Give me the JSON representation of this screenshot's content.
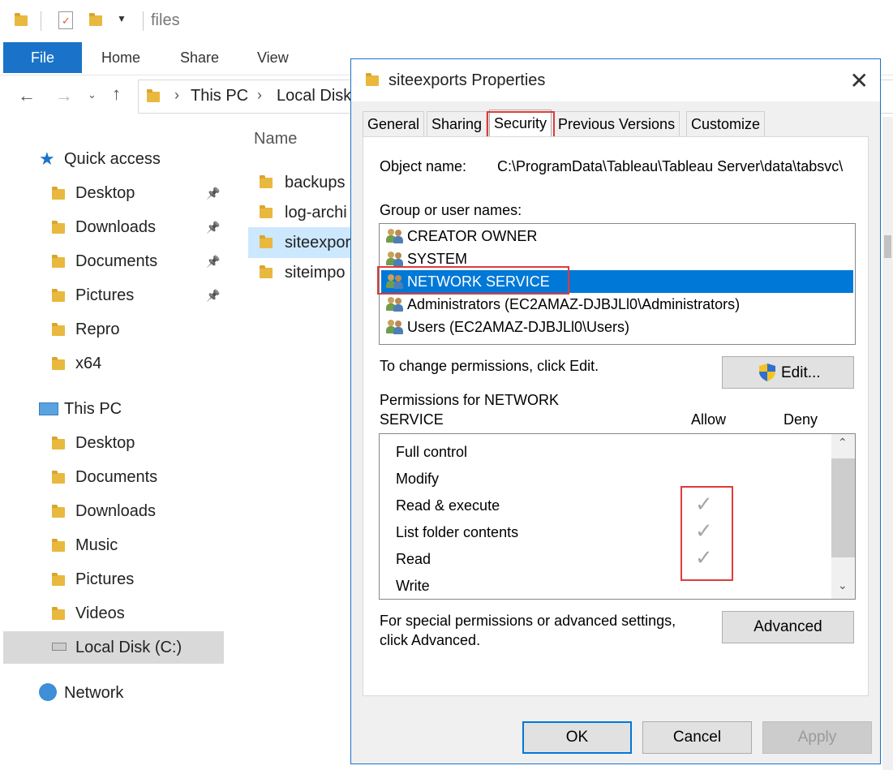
{
  "explorer": {
    "title": "files",
    "ribbon_tabs": [
      "File",
      "Home",
      "Share",
      "View"
    ],
    "address": {
      "crumbs": [
        "This PC",
        "Local Disk"
      ]
    },
    "sidebar": {
      "quick_access": "Quick access",
      "quick_items": [
        {
          "label": "Desktop",
          "pinned": true,
          "icon": "desktop-folder-icon"
        },
        {
          "label": "Downloads",
          "pinned": true,
          "icon": "downloads-folder-icon"
        },
        {
          "label": "Documents",
          "pinned": true,
          "icon": "documents-folder-icon"
        },
        {
          "label": "Pictures",
          "pinned": true,
          "icon": "pictures-folder-icon"
        },
        {
          "label": "Repro",
          "pinned": false,
          "icon": "folder-icon"
        },
        {
          "label": "x64",
          "pinned": false,
          "icon": "folder-icon"
        }
      ],
      "this_pc": "This PC",
      "pc_items": [
        {
          "label": "Desktop",
          "icon": "desktop-folder-icon"
        },
        {
          "label": "Documents",
          "icon": "documents-folder-icon"
        },
        {
          "label": "Downloads",
          "icon": "downloads-folder-icon"
        },
        {
          "label": "Music",
          "icon": "music-folder-icon"
        },
        {
          "label": "Pictures",
          "icon": "pictures-folder-icon"
        },
        {
          "label": "Videos",
          "icon": "videos-folder-icon"
        },
        {
          "label": "Local Disk (C:)",
          "icon": "drive-icon",
          "selected": true
        }
      ],
      "network": "Network"
    },
    "content": {
      "column_name": "Name",
      "files": [
        {
          "name": "backups"
        },
        {
          "name": "log-archi"
        },
        {
          "name": "siteexpor",
          "selected": true
        },
        {
          "name": "siteimpo"
        }
      ]
    }
  },
  "dialog": {
    "title": "siteexports Properties",
    "tabs": [
      "General",
      "Sharing",
      "Security",
      "Previous Versions",
      "Customize"
    ],
    "active_tab": "Security",
    "object_name_label": "Object name:",
    "object_name_value": "C:\\ProgramData\\Tableau\\Tableau Server\\data\\tabsvc\\",
    "group_label": "Group or user names:",
    "users": [
      {
        "name": "CREATOR OWNER"
      },
      {
        "name": "SYSTEM"
      },
      {
        "name": "NETWORK SERVICE",
        "selected": true
      },
      {
        "name": "Administrators (EC2AMAZ-DJBJLl0\\Administrators)"
      },
      {
        "name": "Users (EC2AMAZ-DJBJLl0\\Users)"
      }
    ],
    "change_hint": "To change permissions, click Edit.",
    "edit_button": "Edit...",
    "permissions_for_line1": "Permissions for NETWORK",
    "permissions_for_line2": "SERVICE",
    "allow_header": "Allow",
    "deny_header": "Deny",
    "permissions": [
      {
        "name": "Full control",
        "allow": false,
        "deny": false
      },
      {
        "name": "Modify",
        "allow": false,
        "deny": false
      },
      {
        "name": "Read & execute",
        "allow": true,
        "deny": false
      },
      {
        "name": "List folder contents",
        "allow": true,
        "deny": false
      },
      {
        "name": "Read",
        "allow": true,
        "deny": false
      },
      {
        "name": "Write",
        "allow": false,
        "deny": false
      }
    ],
    "special_line1": "For special permissions or advanced settings,",
    "special_line2": "click Advanced.",
    "advanced_button": "Advanced",
    "ok_button": "OK",
    "cancel_button": "Cancel",
    "apply_button": "Apply"
  },
  "colors": {
    "accent": "#0078d7",
    "highlight_box": "#e03a3a",
    "file_tab": "#1a73c8"
  }
}
